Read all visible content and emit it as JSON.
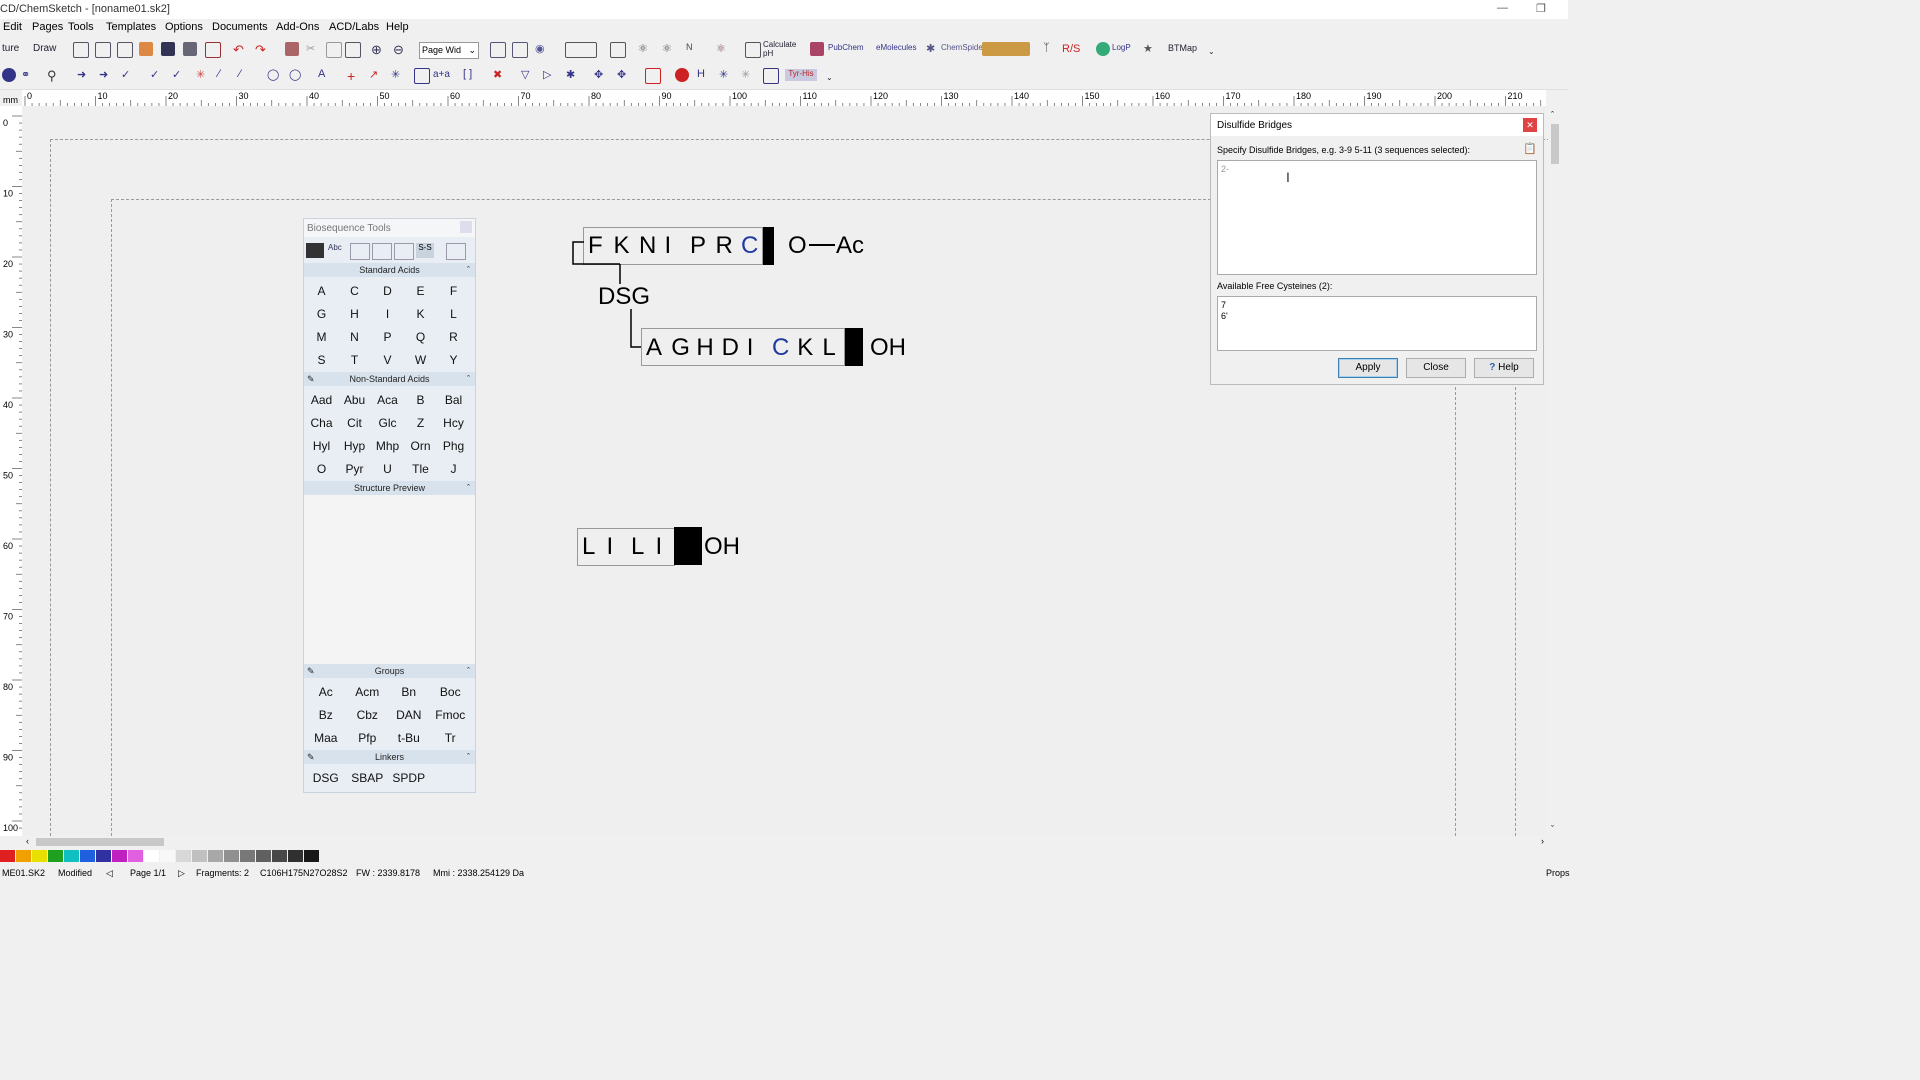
{
  "window": {
    "title": "CD/ChemSketch - [noname01.sk2]"
  },
  "menu": [
    "Edit",
    "Pages",
    "Tools",
    "Templates",
    "Options",
    "Documents",
    "Add-Ons",
    "ACD/Labs",
    "Help"
  ],
  "toolbar": {
    "mode_structure": "ture",
    "mode_draw": "Draw",
    "zoom_select": "Page Wid",
    "calculate_ph": "Calculate pH",
    "pubchem": "PubChem",
    "emolecules": "eMolecules",
    "chemspider": "ChemSpider",
    "rs": "R/S",
    "logp": "LogP",
    "btmap": "BTMap",
    "tyr_his": "Tyr-His"
  },
  "ruler": {
    "unit": "mm",
    "h_ticks": [
      "0",
      "10",
      "20",
      "30",
      "40",
      "50",
      "60",
      "70",
      "80",
      "90",
      "100",
      "110",
      "120",
      "130",
      "140",
      "150",
      "160",
      "170",
      "180",
      "190",
      "200",
      "210"
    ],
    "v_ticks": [
      "0",
      "10",
      "20",
      "30",
      "40",
      "50",
      "60",
      "70",
      "80",
      "90",
      "100"
    ]
  },
  "canvas": {
    "seq1": {
      "residues": [
        "F",
        "K",
        "N",
        "I",
        "P",
        "R",
        "C"
      ],
      "tail_o": "O",
      "tail_ac": "Ac"
    },
    "linker": "DSG",
    "seq2": {
      "residues": [
        "A",
        "G",
        "H",
        "D",
        "I",
        "C",
        "K",
        "L"
      ],
      "tail": "OH"
    },
    "seq3": {
      "residues": [
        "L",
        "I",
        "L",
        "I"
      ],
      "tail": "OH"
    },
    "highlight_color": "#1f3aa0"
  },
  "biosequence_tools": {
    "title": "Biosequence Tools",
    "standard_header": "Standard Acids",
    "standard_acids": [
      "A",
      "C",
      "D",
      "E",
      "F",
      "G",
      "H",
      "I",
      "K",
      "L",
      "M",
      "N",
      "P",
      "Q",
      "R",
      "S",
      "T",
      "V",
      "W",
      "Y"
    ],
    "nonstandard_header": "Non-Standard Acids",
    "nonstandard_acids": [
      "Aad",
      "Abu",
      "Aca",
      "B",
      "Bal",
      "Cha",
      "Cit",
      "Glc",
      "Z",
      "Hcy",
      "Hyl",
      "Hyp",
      "Mhp",
      "Orn",
      "Phg",
      "O",
      "Pyr",
      "U",
      "Tle",
      "J"
    ],
    "preview_header": "Structure Preview",
    "groups_header": "Groups",
    "groups": [
      "Ac",
      "Acm",
      "Bn",
      "Boc",
      "Bz",
      "Cbz",
      "DAN",
      "Fmoc",
      "Maa",
      "Pfp",
      "t-Bu",
      "Tr"
    ],
    "linkers_header": "Linkers",
    "linkers": [
      "DSG",
      "SBAP",
      "SPDP"
    ]
  },
  "dialog": {
    "title": "Disulfide Bridges",
    "prompt": "Specify Disulfide Bridges, e.g. 3-9 5-11 (3 sequences selected):",
    "input_value": "2-",
    "cysteines_label": "Available Free Cysteines (2):",
    "cysteines": [
      "7",
      "6'"
    ],
    "apply": "Apply",
    "close": "Close",
    "help": "Help"
  },
  "status": {
    "file": "ME01.SK2",
    "state": "Modified",
    "page": "Page 1/1",
    "fragments": "Fragments: 2",
    "formula": "C106H175N27O28S2",
    "fw": "FW : 2339.8178",
    "mmi": "Mmi : 2338.254129 Da",
    "right": "Props"
  },
  "palette_colors": [
    "#e02020",
    "#f0a000",
    "#e8e000",
    "#20a020",
    "#10c0c0",
    "#2060e0",
    "#3030a0",
    "#c020c0",
    "#e060e0",
    "#ffffff",
    "#f8f8f8",
    "#d8d8d8",
    "#c0c0c0",
    "#a8a8a8",
    "#909090",
    "#787878",
    "#606060",
    "#484848",
    "#303030",
    "#181818"
  ]
}
